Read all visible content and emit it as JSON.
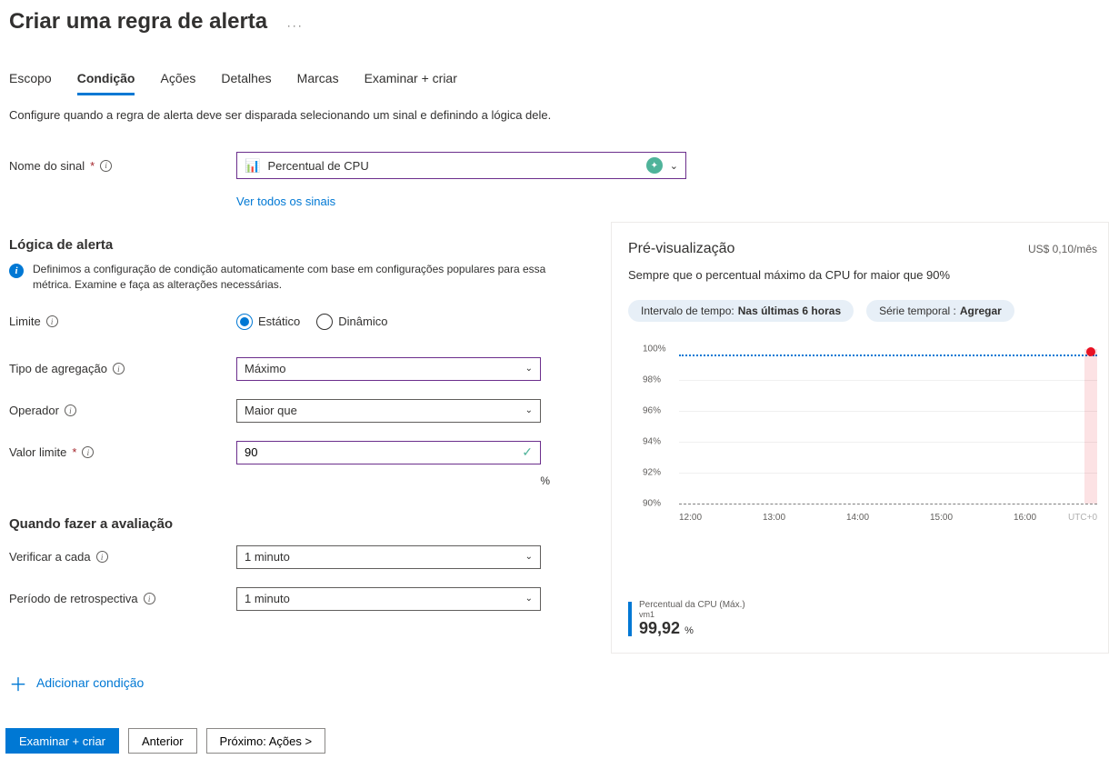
{
  "page": {
    "title": "Criar uma regra de alerta",
    "more": "···",
    "description": "Configure quando a regra de alerta deve ser disparada selecionando um sinal e definindo a lógica dele."
  },
  "tabs": {
    "scope": "Escopo",
    "condition": "Condição",
    "actions": "Ações",
    "details": "Detalhes",
    "tags": "Marcas",
    "review": "Examinar + criar"
  },
  "signal": {
    "label": "Nome do sinal",
    "value": "Percentual de CPU",
    "see_all": "Ver todos os sinais"
  },
  "logic": {
    "heading": "Lógica de alerta",
    "info": "Definimos a configuração de condição automaticamente com base em configurações populares para essa métrica. Examine e faça as alterações necessárias.",
    "threshold_label": "Limite",
    "threshold_static": "Estático",
    "threshold_dynamic": "Dinâmico",
    "agg_label": "Tipo de agregação",
    "agg_value": "Máximo",
    "op_label": "Operador",
    "op_value": "Maior que",
    "thval_label": "Valor limite",
    "thval_value": "90",
    "unit": "%"
  },
  "eval": {
    "heading": "Quando fazer a avaliação",
    "check_label": "Verificar a cada",
    "check_value": "1 minuto",
    "lookback_label": "Período de retrospectiva",
    "lookback_value": "1 minuto"
  },
  "add_condition": "Adicionar condição",
  "preview": {
    "title": "Pré-visualização",
    "cost": "US$ 0,10/mês",
    "summary": "Sempre que o percentual máximo da CPU for maior que 90%",
    "pill_time_label": "Intervalo de tempo: ",
    "pill_time_value": "Nas últimas 6 horas",
    "pill_series_label": "Série temporal : ",
    "pill_series_value": "Agregar",
    "legend_metric": "Percentual da CPU (Máx.)",
    "legend_resource": "vm1",
    "legend_value": "99,92",
    "legend_unit": "%",
    "utc": "UTC+0"
  },
  "chart_data": {
    "type": "line",
    "x_labels": [
      "12:00",
      "13:00",
      "14:00",
      "15:00",
      "16:00"
    ],
    "y_ticks": [
      "100%",
      "98%",
      "96%",
      "94%",
      "92%",
      "90%"
    ],
    "threshold_line_at": "90%",
    "data_line_at": "100%",
    "ylim": [
      90,
      100
    ]
  },
  "footer": {
    "review": "Examinar + criar",
    "prev": "Anterior",
    "next": "Próximo: Ações >"
  }
}
